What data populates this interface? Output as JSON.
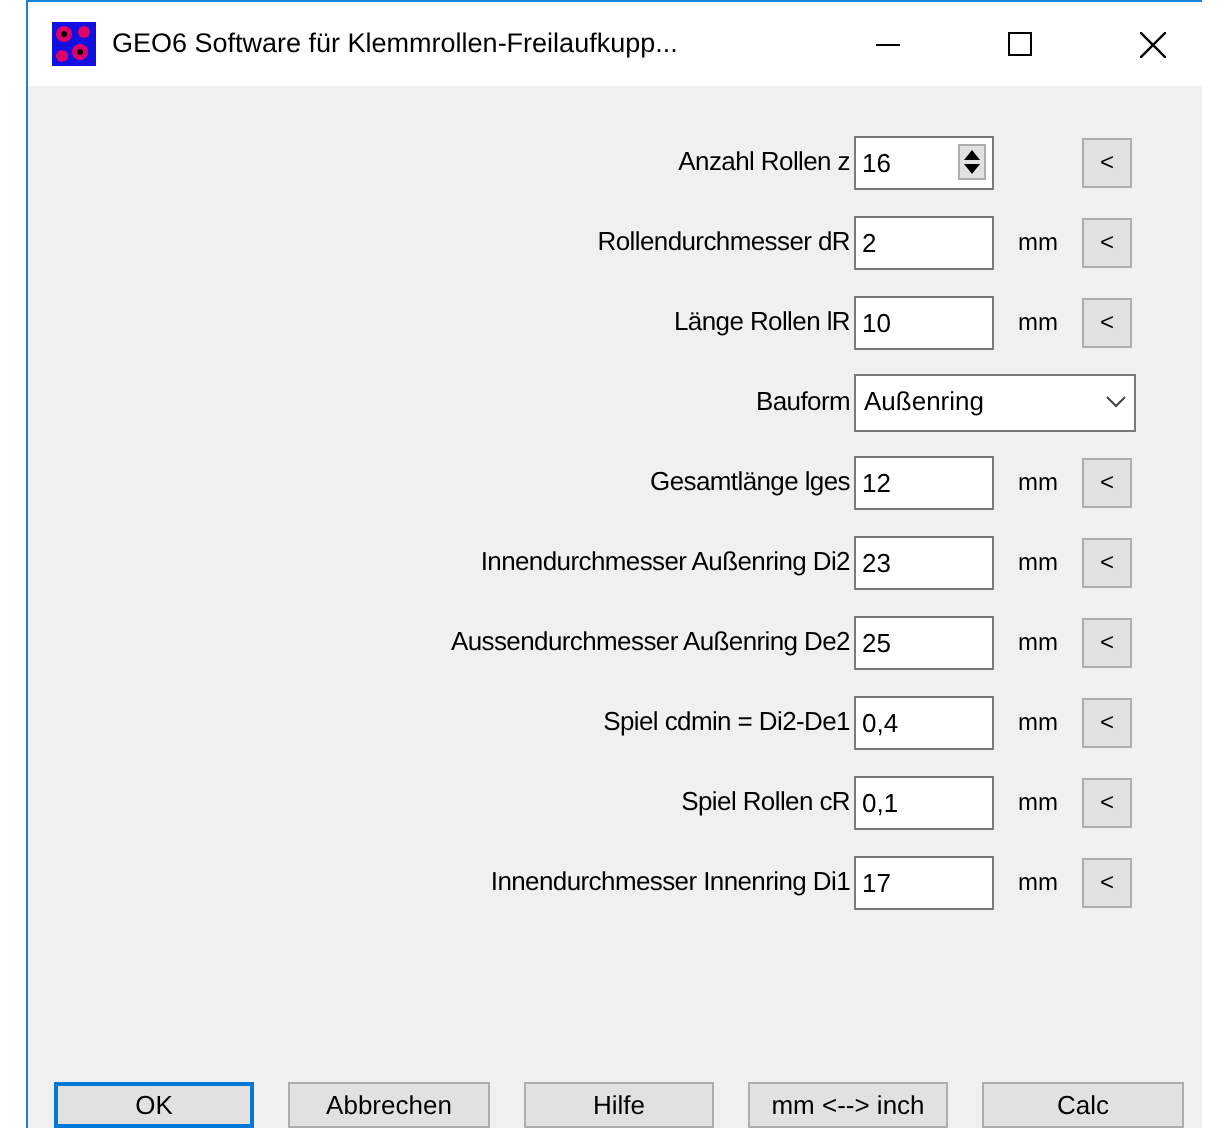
{
  "window": {
    "title": "GEO6  Software für Klemmrollen-Freilaufkupp..."
  },
  "fields": [
    {
      "kind": "spin",
      "label": "Anzahl Rollen z",
      "value": "16",
      "button": "<"
    },
    {
      "kind": "text",
      "label": "Rollendurchmesser dR",
      "value": "2",
      "unit": "mm",
      "button": "<"
    },
    {
      "kind": "text",
      "label": "Länge Rollen lR",
      "value": "10",
      "unit": "mm",
      "button": "<"
    },
    {
      "kind": "select",
      "label": "Bauform",
      "value": "Außenring"
    },
    {
      "kind": "text",
      "label": "Gesamtlänge lges",
      "value": "12",
      "unit": "mm",
      "button": "<"
    },
    {
      "kind": "text",
      "label": "Innendurchmesser Außenring Di2",
      "value": "23",
      "unit": "mm",
      "button": "<"
    },
    {
      "kind": "text",
      "label": "Aussendurchmesser Außenring De2",
      "value": "25",
      "unit": "mm",
      "button": "<"
    },
    {
      "kind": "text",
      "label": "Spiel cdmin = Di2-De1",
      "value": "0,4",
      "unit": "mm",
      "button": "<"
    },
    {
      "kind": "text",
      "label": "Spiel Rollen cR",
      "value": "0,1",
      "unit": "mm",
      "button": "<"
    },
    {
      "kind": "text",
      "label": "Innendurchmesser Innenring Di1",
      "value": "17",
      "unit": "mm",
      "button": "<"
    }
  ],
  "buttons": [
    {
      "label": "OK",
      "default": true
    },
    {
      "label": "Abbrechen",
      "default": false
    },
    {
      "label": "Hilfe",
      "default": false
    },
    {
      "label": "mm <--> inch",
      "default": false
    },
    {
      "label": "Calc",
      "default": false
    }
  ]
}
